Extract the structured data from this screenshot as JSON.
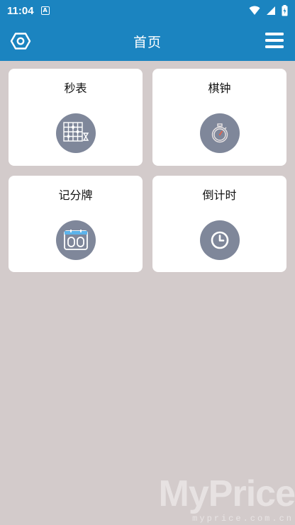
{
  "status_bar": {
    "time": "11:04",
    "notification_letter": "A"
  },
  "app_bar": {
    "title": "首页"
  },
  "cards": [
    {
      "id": "stopwatch",
      "label": "秒表",
      "icon": "chessboard-icon"
    },
    {
      "id": "chess-clock",
      "label": "棋钟",
      "icon": "stopwatch-icon"
    },
    {
      "id": "scoreboard",
      "label": "记分牌",
      "icon": "scoreboard-icon"
    },
    {
      "id": "countdown",
      "label": "倒计时",
      "icon": "clock-icon"
    }
  ],
  "colors": {
    "primary": "#1b84c0",
    "background": "#d3cbcb",
    "card": "#ffffff",
    "icon_circle": "#7f879a"
  },
  "watermark": {
    "text": "MyPrice",
    "sub": "myprice.com.cn"
  }
}
